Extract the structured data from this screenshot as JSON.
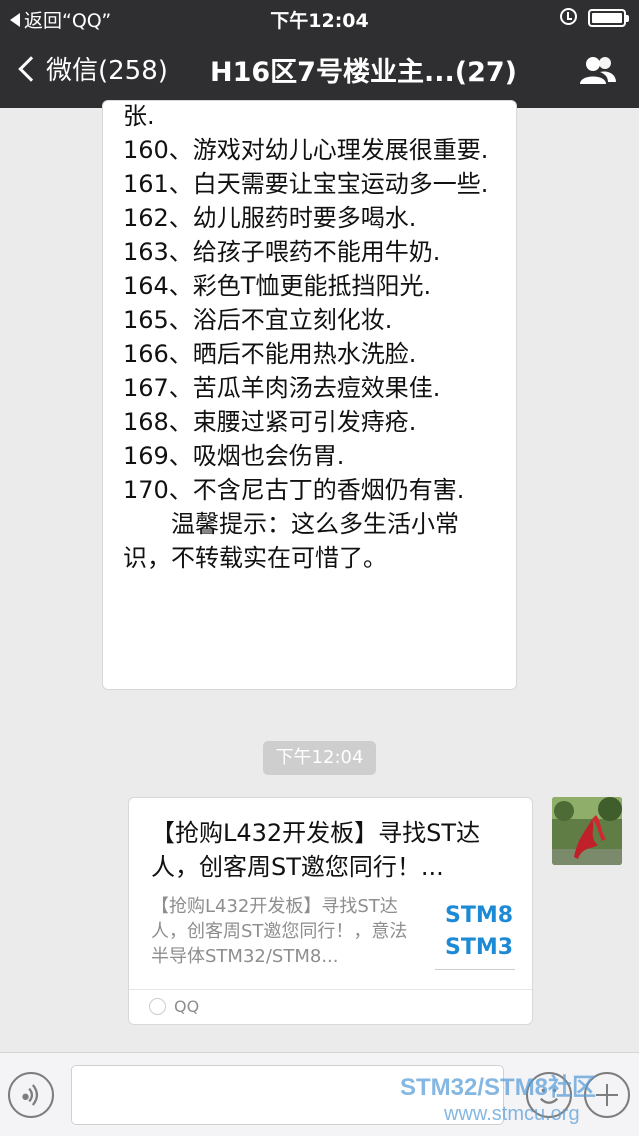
{
  "status_bar": {
    "back_app": "返回“QQ”",
    "time": "下午12:04"
  },
  "nav": {
    "back_label": "微信(258)",
    "title": "H16区7号楼业主...(27)"
  },
  "message_text": {
    "lines": [
      "张.",
      "160、游戏对幼儿心理发展很重要.",
      "161、白天需要让宝宝运动多一些.",
      "162、幼儿服药时要多喝水.",
      "163、给孩子喂药不能用牛奶.",
      "164、彩色T恤更能抵挡阳光.",
      "165、浴后不宜立刻化妆.",
      "166、晒后不能用热水洗脸.",
      "167、苦瓜羊肉汤去痘效果佳.",
      "168、束腰过紧可引发痔疮.",
      "169、吸烟也会伤胃.",
      "170、不含尼古丁的香烟仍有害.",
      "　　温馨提示：这么多生活小常识，不转载实在可惜了。"
    ]
  },
  "timestamp_chip": "下午12:04",
  "link_card": {
    "title": "【抢购L432开发板】寻找ST达人，创客周ST邀您同行！...",
    "description": "【抢购L432开发板】寻找ST达人，创客周ST邀您同行！，意法半导体STM32/STM8...",
    "thumb_text": [
      "STM8",
      "STM3"
    ],
    "source": "QQ"
  },
  "watermark": {
    "line1": "STM32/STM8社区",
    "line2": "www.stmcu.org"
  },
  "colors": {
    "header_bg": "#2f2f31",
    "chat_bg": "#ebebeb",
    "thumb_blue": "#1d8ad6",
    "watermark_blue": "#5c9fd8"
  }
}
